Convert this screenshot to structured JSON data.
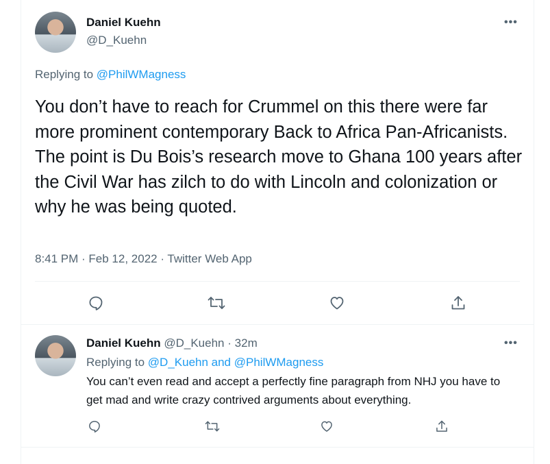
{
  "tweet": {
    "author_name": "Daniel Kuehn",
    "author_handle": "@D_Kuehn",
    "more_label": "•••",
    "replying_prefix": "Replying to ",
    "replying_to": "@PhilWMagness",
    "text": "You don’t have to reach for Crummel on this there were far more prominent contemporary Back to Africa Pan-Africanists. The point is Du Bois’s research move to Ghana 100 years after the Civil War has zilch to do with Lincoln and colonization or why he was being quoted.",
    "timestamp": "8:41 PM · Feb 12, 2022 · Twitter Web App",
    "actions": [
      "reply-icon",
      "retweet-icon",
      "like-icon",
      "share-icon"
    ]
  },
  "reply": {
    "author_name": "Daniel Kuehn",
    "author_handle": "@D_Kuehn",
    "separator": "·",
    "time": "32m",
    "more_label": "•••",
    "replying_prefix": "Replying to ",
    "replying_to": "@D_Kuehn and @PhilWMagness",
    "text": "You can’t even read and accept a perfectly fine paragraph from NHJ you have to get mad and write crazy contrived arguments about everything.",
    "actions": [
      "reply-icon",
      "retweet-icon",
      "like-icon",
      "share-icon"
    ]
  },
  "colors": {
    "text": "#0f1419",
    "secondary": "#536471",
    "link": "#1d9bf0",
    "border": "#eff3f4"
  }
}
